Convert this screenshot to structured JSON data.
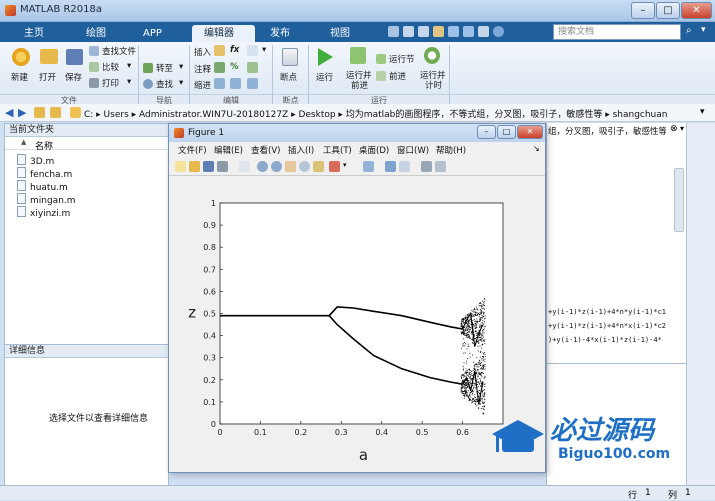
{
  "app": {
    "title": "MATLAB R2018a",
    "window_controls": [
      "–",
      "□",
      "✕"
    ]
  },
  "tabs": [
    "主页",
    "绘图",
    "APP",
    "编辑器",
    "发布",
    "视图"
  ],
  "active_tab": "编辑器",
  "search": {
    "placeholder": "搜索文档"
  },
  "toolstrip": {
    "file": {
      "section": "文件",
      "new": "新建",
      "open": "打开",
      "save": "保存",
      "find_files": "查找文件",
      "compare": "比较",
      "print": "打印"
    },
    "nav": {
      "section": "导航",
      "goto": "转至",
      "find": "查找"
    },
    "edit": {
      "section": "编辑",
      "insert": "插入",
      "comment": "注释",
      "indent": "缩进"
    },
    "breakpoints": {
      "section": "断点",
      "label": "断点"
    },
    "run": {
      "section": "运行",
      "run": "运行",
      "run_advance_1": "运行并",
      "run_advance_2": "前进",
      "run_section": "运行节",
      "advance": "前进",
      "run_time_1": "运行并",
      "run_time_2": "计时"
    }
  },
  "address": {
    "path": "C: ▸ Users ▸ Administrator.WIN7U-20180127Z ▸ Desktop ▸ 均为matlab的画图程序，不等式组，分叉图，吸引子，敏感性等 ▸ shangchuan"
  },
  "file_panel": {
    "title": "当前文件夹",
    "column": "名称",
    "arrow": "▲",
    "files": [
      "3D.m",
      "fencha.m",
      "huatu.m",
      "mingan.m",
      "xiyinzi.m"
    ]
  },
  "detail_panel": {
    "title": "详细信息",
    "empty_msg": "选择文件以查看详细信息"
  },
  "command": {
    "header": "组，分叉图，吸引子，敏感性等",
    "lines": [
      "+y(i-1)*z(i-1)+4*n*y(i-1)*c1",
      "+y(i-1)*z(i-1)+4*n*x(i-1)*c2",
      ")+y(i-1)-4*x(i-1)*z(i-1)-4*"
    ]
  },
  "status": {
    "row_label": "行",
    "row": "1",
    "col_label": "列",
    "col": "1"
  },
  "figure": {
    "title": "Figure 1",
    "menu": [
      "文件(F)",
      "编辑(E)",
      "查看(V)",
      "插入(I)",
      "工具(T)",
      "桌面(D)",
      "窗口(W)",
      "帮助(H)"
    ]
  },
  "chart_data": {
    "type": "scatter",
    "title": "",
    "xlabel": "a",
    "ylabel": "z",
    "xlim": [
      0,
      0.7
    ],
    "ylim": [
      0,
      1
    ],
    "xticks": [
      "0",
      "0.1",
      "0.2",
      "0.3",
      "0.4",
      "0.5",
      "0.6"
    ],
    "yticks": [
      "0",
      "0.1",
      "0.2",
      "0.3",
      "0.4",
      "0.5",
      "0.6",
      "0.7",
      "0.8",
      "0.9",
      "1"
    ],
    "grid": false,
    "series": [
      {
        "x": [
          0,
          0.05,
          0.1,
          0.15,
          0.2,
          0.25,
          0.27
        ],
        "y": [
          0.49,
          0.49,
          0.49,
          0.49,
          0.49,
          0.49,
          0.49
        ]
      },
      {
        "x": [
          0.27,
          0.29,
          0.33,
          0.38,
          0.45,
          0.52,
          0.57,
          0.6
        ],
        "y": [
          0.49,
          0.53,
          0.525,
          0.51,
          0.49,
          0.46,
          0.44,
          0.43
        ]
      },
      {
        "x": [
          0.27,
          0.29,
          0.33,
          0.38,
          0.45,
          0.52,
          0.57,
          0.6
        ],
        "y": [
          0.49,
          0.45,
          0.385,
          0.31,
          0.25,
          0.21,
          0.19,
          0.18
        ]
      },
      {
        "x": [
          0.6,
          0.61,
          0.62,
          0.63,
          0.64,
          0.65
        ],
        "y": [
          0.43,
          0.47,
          0.5,
          0.35,
          0.41,
          0.45
        ]
      },
      {
        "x": [
          0.6,
          0.61,
          0.62,
          0.63,
          0.64,
          0.65
        ],
        "y": [
          0.18,
          0.21,
          0.15,
          0.24,
          0.09,
          0.19
        ]
      }
    ]
  },
  "watermark": {
    "brand": "必过源码",
    "url": "Biguo100.com"
  }
}
